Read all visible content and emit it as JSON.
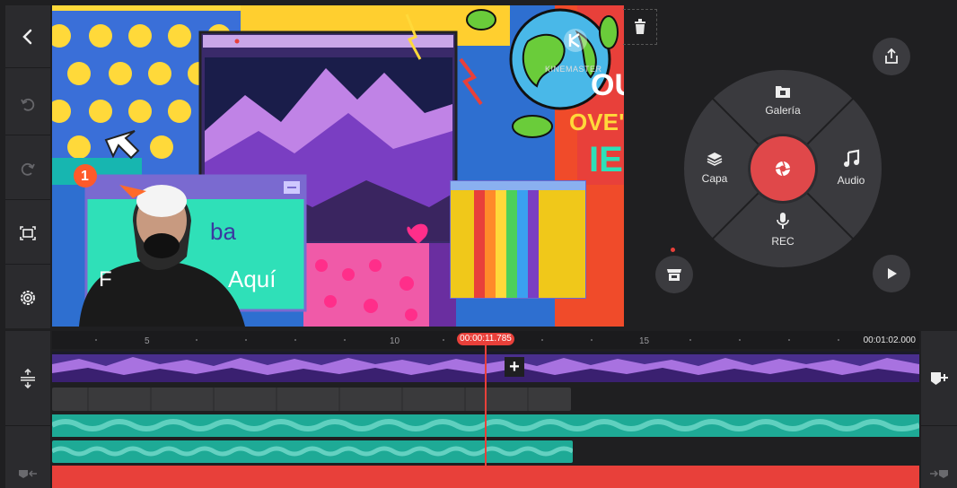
{
  "preview": {
    "watermark": "KINEMASTER",
    "title_fragment": "ba",
    "subtitle_fragment": "Aquí",
    "fragment_left": "F",
    "side_text_1": "OU",
    "side_text_2": "OVE\"",
    "side_text_3": "IE",
    "badge": "1"
  },
  "wheel": {
    "media": "Galería",
    "layer": "Capa",
    "audio": "Audio",
    "voice": "REC"
  },
  "timeline": {
    "playhead_time": "00:00:11.785",
    "end_time": "00:01:02.000",
    "ticks": [
      "5",
      "10",
      "15"
    ]
  },
  "colors": {
    "accent": "#e8403a",
    "audio": "#1eaa96",
    "video": "#5a3aa8"
  }
}
